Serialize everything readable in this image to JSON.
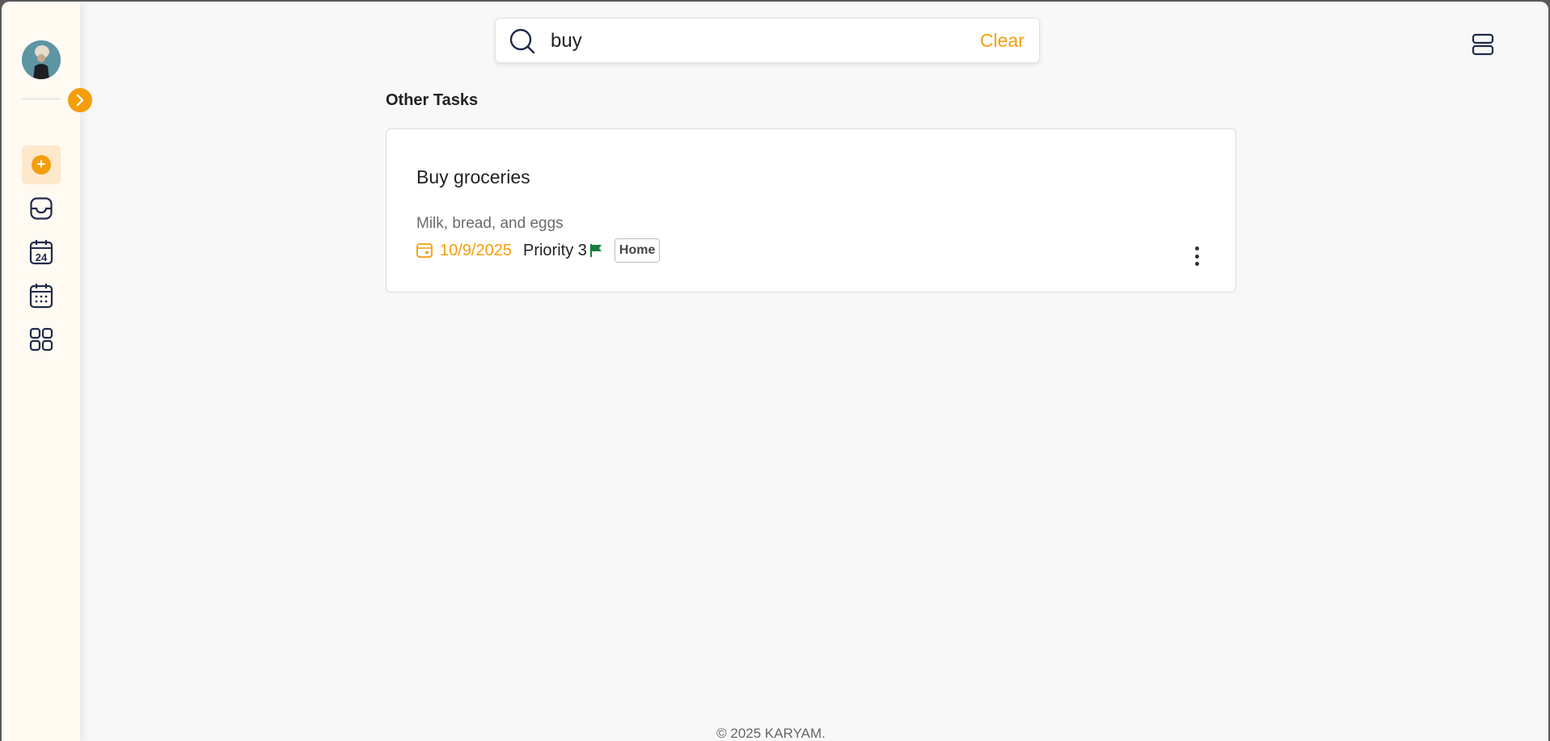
{
  "search": {
    "value": "buy",
    "clear_label": "Clear"
  },
  "section": {
    "title": "Other Tasks"
  },
  "tasks": [
    {
      "title": "Buy groceries",
      "description": "Milk, bread, and eggs",
      "date": "10/9/2025",
      "priority": "Priority 3",
      "tag": "Home"
    }
  ],
  "sidebar": {
    "items": [
      {
        "name": "add-task",
        "icon": "plus-circle-icon"
      },
      {
        "name": "inbox",
        "icon": "inbox-tray-icon"
      },
      {
        "name": "today",
        "icon": "calendar-24-icon"
      },
      {
        "name": "upcoming",
        "icon": "calendar-grid-icon"
      },
      {
        "name": "apps",
        "icon": "grid-icon"
      }
    ]
  },
  "footer": {
    "text": "© 2025 KARYAM."
  },
  "colors": {
    "accent": "#f59e0b",
    "flag": "#15803d",
    "sidebar_bg": "#fffaf2",
    "page_bg": "#f8f8f8",
    "icon_stroke": "#1e2a4a"
  }
}
